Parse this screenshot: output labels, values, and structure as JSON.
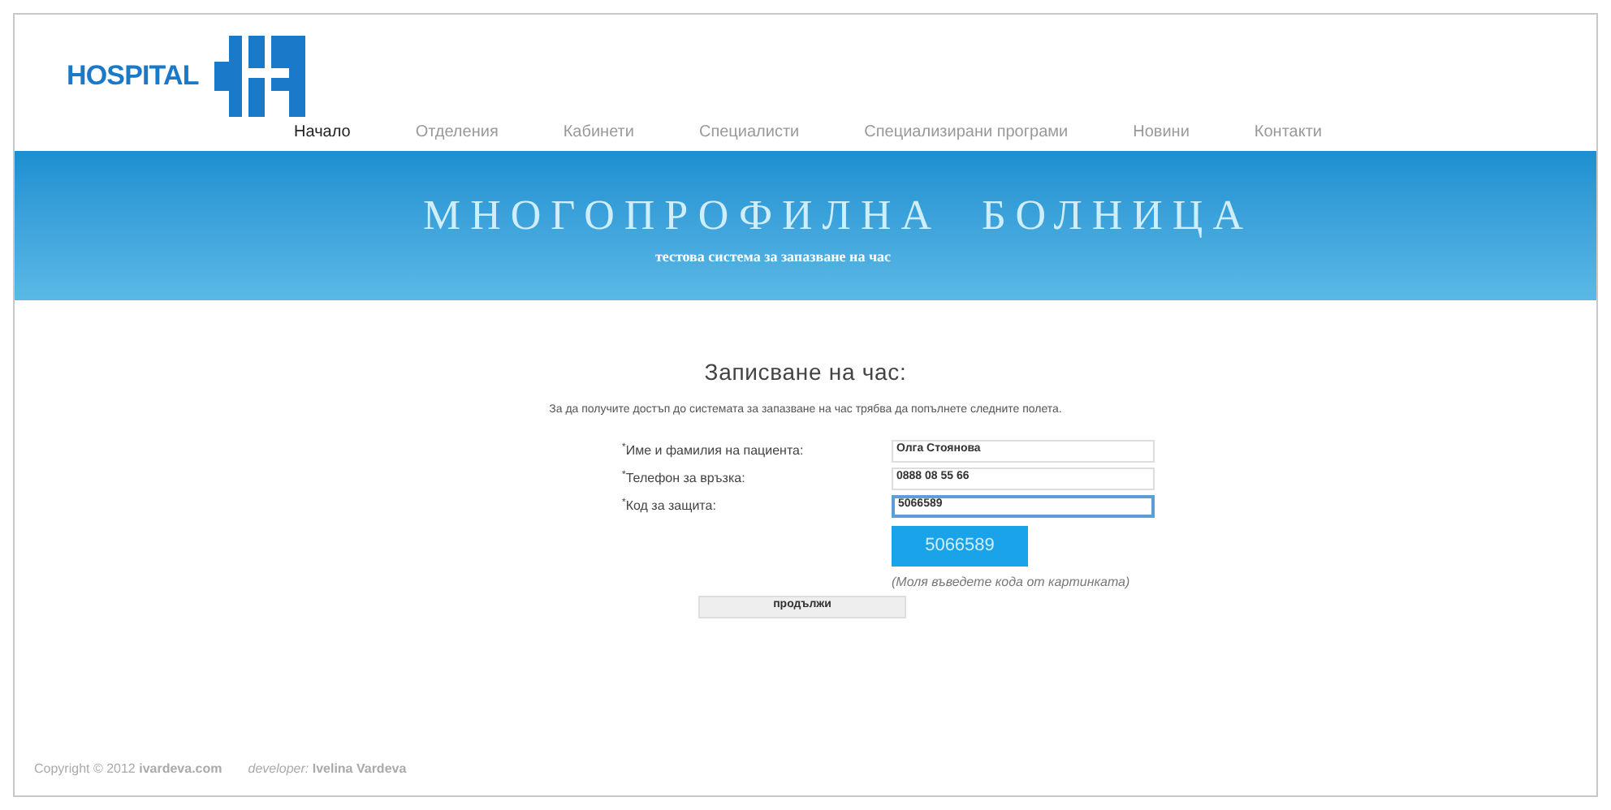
{
  "logo": {
    "text": "HOSPITAL"
  },
  "nav": [
    {
      "label": "Начало",
      "selected": true
    },
    {
      "label": "Отделения",
      "selected": false
    },
    {
      "label": "Кабинети",
      "selected": false
    },
    {
      "label": "Специалисти",
      "selected": false
    },
    {
      "label": "Специализирани програми",
      "selected": false
    },
    {
      "label": "Новини",
      "selected": false
    },
    {
      "label": "Контакти",
      "selected": false
    }
  ],
  "banner": {
    "title": "МНОГОПРОФИЛНА  БОЛНИЦА",
    "subtitle": "тестова система за запазване на час"
  },
  "form": {
    "heading": "Записване на час:",
    "intro": "За да получите достъп до системата за запазване на час трябва да попълнете следните полета.",
    "fields": [
      {
        "label": "$^{*}$Име и фамилия на пациента:",
        "value": "Олга Стоянова",
        "focused": false
      },
      {
        "label": "$^{*}$Телефон за връзка:",
        "value": "0888 08 55 66",
        "focused": false
      },
      {
        "label": "$^{*}$Код за защита:",
        "value": "5066589",
        "focused": true
      }
    ],
    "captcha": "5066589",
    "hint": "(Моля въведете кода от картинката)",
    "submit": "продължи"
  },
  "footer": {
    "copyright": "Copyright © 2012 **ivardeva.com**",
    "developer": "*developer:* **Ivelina Vardeva**"
  }
}
